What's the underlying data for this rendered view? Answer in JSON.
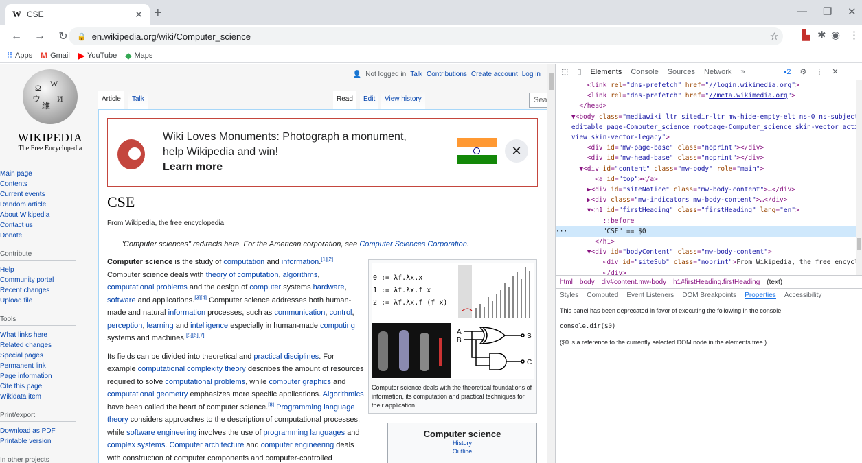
{
  "browser": {
    "tab_title": "CSE",
    "tab_favicon": "W",
    "url": "en.wikipedia.org/wiki/Computer_science",
    "bookmarks": [
      {
        "label": "Apps",
        "icon": "apps-grid-icon",
        "color": "#4285f4"
      },
      {
        "label": "Gmail",
        "icon": "gmail-icon",
        "color": "#ea4335"
      },
      {
        "label": "YouTube",
        "icon": "youtube-icon",
        "color": "#ff0000"
      },
      {
        "label": "Maps",
        "icon": "maps-icon",
        "color": "#34a853"
      }
    ]
  },
  "wiki": {
    "wordmark": "WIKIPEDIA",
    "tagline": "The Free Encyclopedia",
    "personal": {
      "not_logged_in": "Not logged in",
      "talk": "Talk",
      "contributions": "Contributions",
      "create_account": "Create account",
      "log_in": "Log in"
    },
    "tabs": {
      "article": "Article",
      "talk": "Talk",
      "read": "Read",
      "edit": "Edit",
      "history": "View history"
    },
    "search_placeholder": "Search Wikipedia",
    "sidebar": {
      "main": [
        "Main page",
        "Contents",
        "Current events",
        "Random article",
        "About Wikipedia",
        "Contact us",
        "Donate"
      ],
      "contribute_head": "Contribute",
      "contribute": [
        "Help",
        "Community portal",
        "Recent changes",
        "Upload file"
      ],
      "tools_head": "Tools",
      "tools": [
        "What links here",
        "Related changes",
        "Special pages",
        "Permanent link",
        "Page information",
        "Cite this page",
        "Wikidata item"
      ],
      "print_head": "Print/export",
      "print": [
        "Download as PDF",
        "Printable version"
      ],
      "other_head": "In other projects"
    },
    "banner": {
      "line": "Wiki Loves Monuments: Photograph a monument, help Wikipedia and win!",
      "cta": "Learn more",
      "flag_colors": [
        "#ff9933",
        "#ffffff",
        "#138808"
      ]
    },
    "heading": "CSE",
    "site_sub": "From Wikipedia, the free encyclopedia",
    "hatnote_text": "\"Computer sciences\" redirects here. For the American corporation, see ",
    "hatnote_link": "Computer Sciences Corporation",
    "hatnote_end": ".",
    "thumb_caption": "Computer science deals with the theoretical foundations of information, its computation and practical techniques for their application.",
    "lambda": [
      "0 := λf.λx.x",
      "1 := λf.λx.f x",
      "2 := λf.λx.f (f x)"
    ],
    "gate_labels": [
      "A",
      "B",
      "S",
      "C"
    ],
    "infobox_title": "Computer science",
    "infobox_links": [
      "History",
      "Outline"
    ]
  },
  "devtools": {
    "tabs": [
      "Elements",
      "Console",
      "Sources",
      "Network",
      "»"
    ],
    "issues_count": "2",
    "breadcrumbs": [
      "html",
      "body",
      "div#content.mw-body",
      "h1#firstHeading.firstHeading",
      "(text)"
    ],
    "subtabs": [
      "Styles",
      "Computed",
      "Event Listeners",
      "DOM Breakpoints",
      "Properties",
      "Accessibility"
    ],
    "props_msg": "This panel has been deprecated in favor of executing the following in the console:",
    "props_code": "console.dir($0)",
    "props_note": "($0 is a reference to the currently selected DOM node in the elements tree.)"
  }
}
